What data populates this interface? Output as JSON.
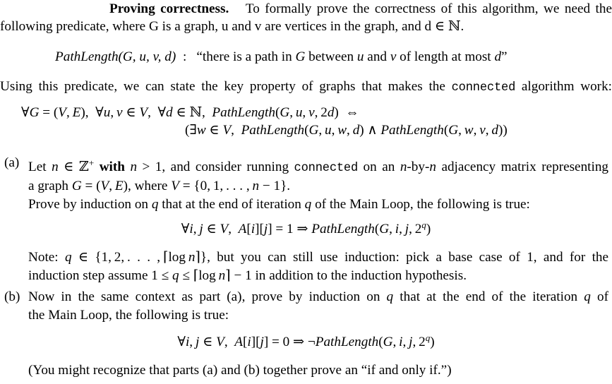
{
  "document": {
    "type": "homework-problem-set",
    "intro": {
      "lead_in": "Proving correctness.",
      "line1_rest": "To formally prove the correctness of this algorithm, we need the",
      "line2": "following predicate, where G is a graph, u and v are vertices in the graph, and d ∈ ℕ."
    },
    "predicate_definition": {
      "name": "PathLength",
      "args": "(G, u, v, d)",
      "separator": ":",
      "description": "“there is a path in G between u and v of length at most d”"
    },
    "key_property_intro": {
      "before_code": "Using this predicate, we can state the key property of graphs that makes the",
      "code": "connected",
      "after_code": "algorithm work:"
    },
    "key_property_equation": {
      "line1": "∀G = (V, E),  ∀u, v ∈ V,  ∀d ∈ ℕ,  PathLength(G, u, v, 2d) ⇔",
      "line2": "(∃w ∈ V,  PathLength(G, u, w, d) ∧ PathLength(G, w, v, d))"
    },
    "parts": [
      {
        "label": "(a)",
        "line1_a": "Let n ∈ ℤ",
        "line1_b": "with n > 1, and consider running",
        "line1_code": "connected",
        "line1_c": "on an n-by-n adjacency matrix representing",
        "line2": "a graph G = (V, E), where V = {0, 1, . . . , n − 1}.",
        "line3": "Prove by induction on q that at the end of iteration q of the Main Loop, the following is true:",
        "equation": "∀i, j ∈ V,  A[i][j] = 1 ⇒ PathLength(G, i, j, 2ᵠ)",
        "note_line1": "Note:  q ∈ {1, 2, . . . , ⌈log n⌉}, but you can still use induction:  pick a base case of 1, and for the",
        "note_line2": "induction step assume 1 ≤ q ≤ ⌈log n⌉ − 1 in addition to the induction hypothesis."
      },
      {
        "label": "(b)",
        "line1": "Now in the same context as part (a), prove by induction on q that at the end of the iteration q of",
        "line2": "the Main Loop, the following is true:",
        "equation": "∀i, j ∈ V,  A[i][j] = 0 ⇒ ¬PathLength(G, i, j, 2ᵠ)",
        "closing": "(You might recognize that parts (a) and (b) together prove an “if and only if.”)"
      }
    ],
    "symbols": {
      "forall": "∀",
      "exists": "∃",
      "in": "∈",
      "iff": "⇔",
      "implies": "⇒",
      "and": "∧",
      "not": "¬",
      "leq": "≤",
      "minus": "−",
      "naturals": "ℕ",
      "integers": "ℤ",
      "ceil_left": "⌈",
      "ceil_right": "⌉",
      "ldots": ". . .",
      "ldots_comma": ", . . . ,"
    },
    "colors": {
      "background": "#ffffff",
      "text": "#000000"
    }
  }
}
